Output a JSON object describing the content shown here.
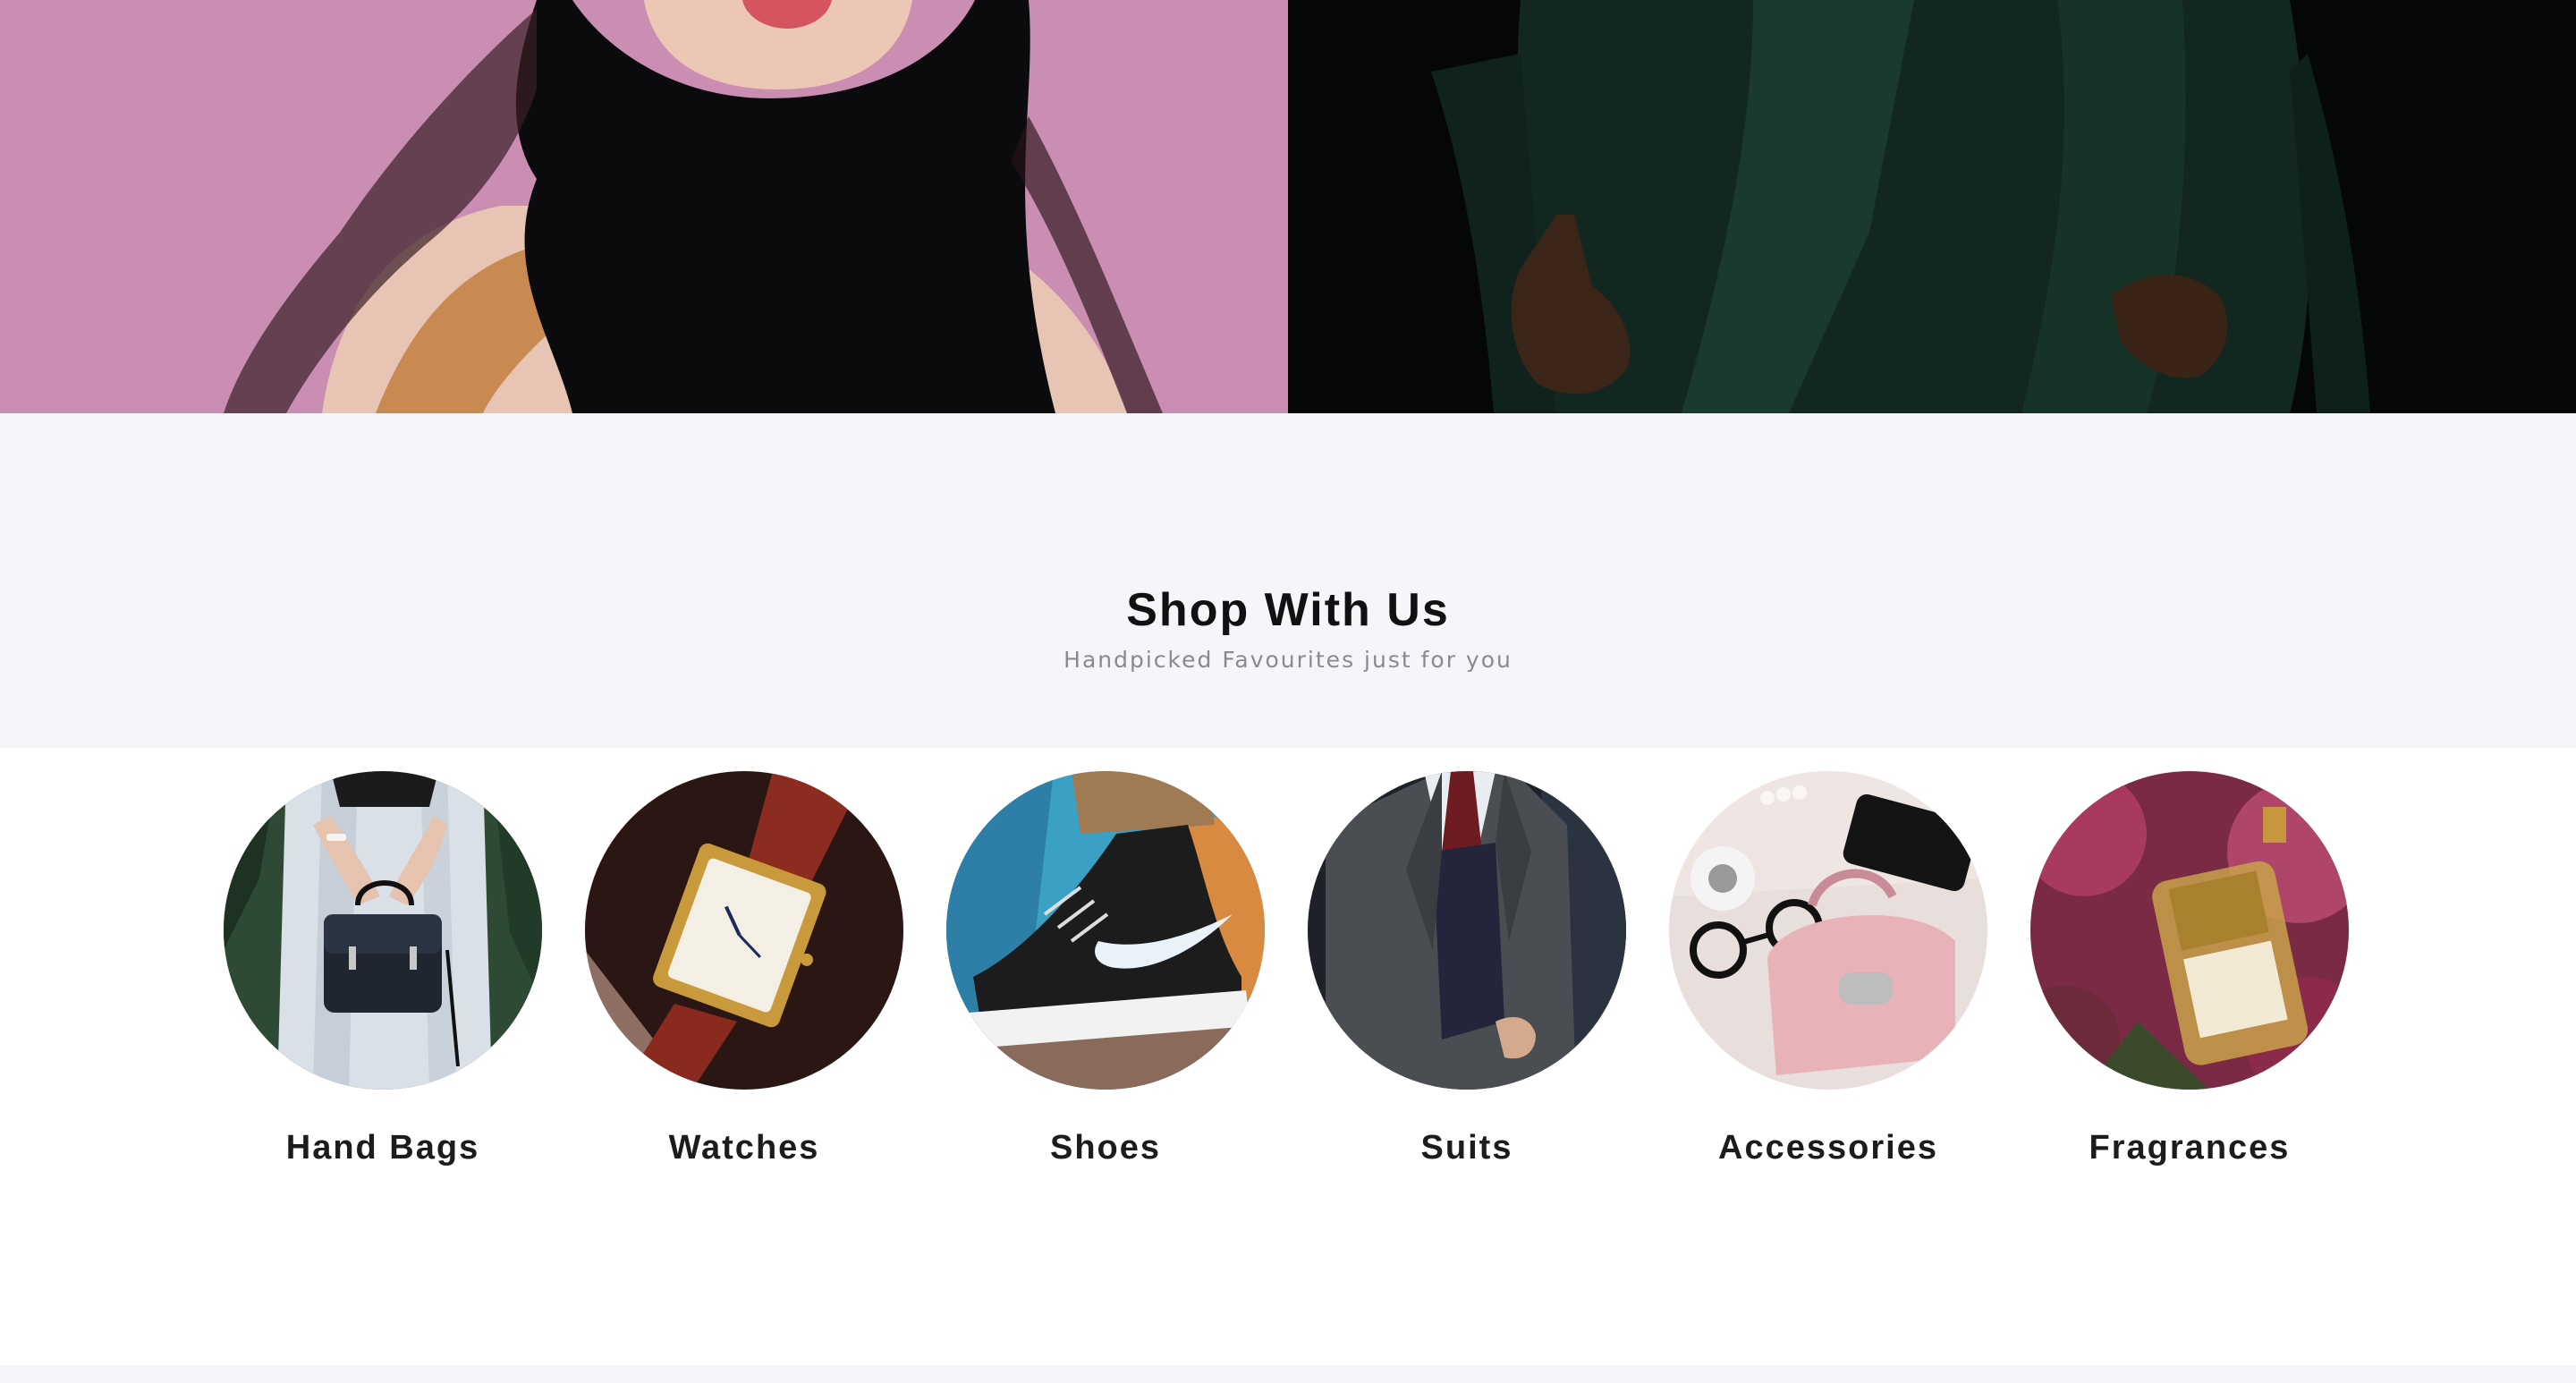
{
  "hero": {
    "left_image": "woman-in-black-scarf-photo",
    "right_image": "man-in-green-suit-photo",
    "left_bg": "#c98eb1",
    "right_bg": "#050706"
  },
  "shop": {
    "title": "Shop With Us",
    "subtitle": "Handpicked Favourites just for you"
  },
  "categories": [
    {
      "label": "Hand Bags",
      "image": "handbag-photo"
    },
    {
      "label": "Watches",
      "image": "watch-photo"
    },
    {
      "label": "Shoes",
      "image": "sneaker-photo"
    },
    {
      "label": "Suits",
      "image": "suit-photo"
    },
    {
      "label": "Accessories",
      "image": "accessories-photo"
    },
    {
      "label": "Fragrances",
      "image": "perfume-photo"
    }
  ],
  "colors": {
    "section_bg": "#f5f6fa",
    "title": "#111111",
    "subtitle": "#8a8a8a",
    "label": "#1c1c1c"
  }
}
